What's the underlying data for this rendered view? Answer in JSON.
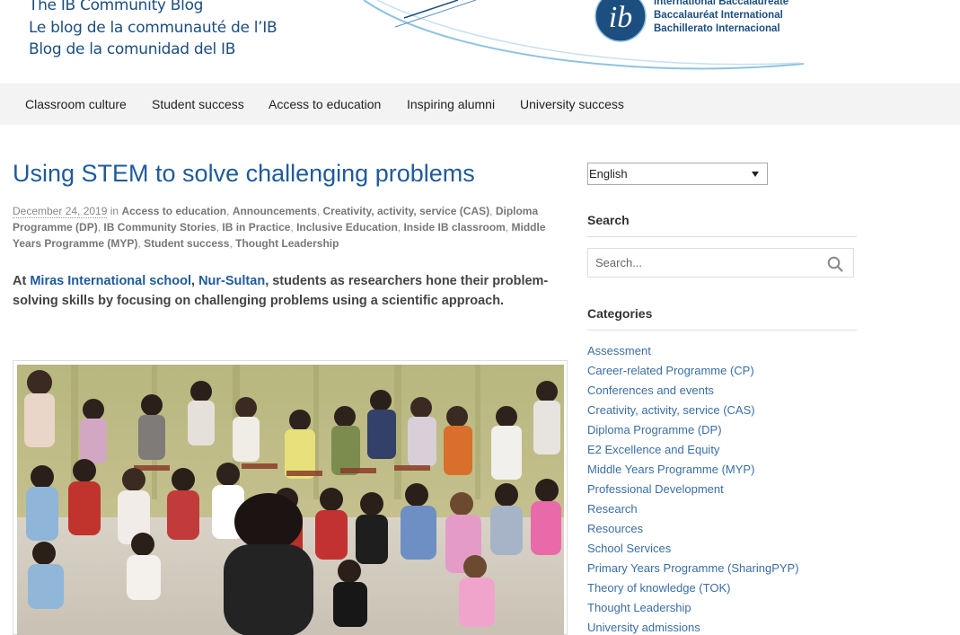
{
  "header": {
    "blog_titles": [
      "The IB Community Blog",
      "Le blog de la communauté de l’IB",
      "Blog de la comunidad del IB"
    ],
    "ib_logo_text": "ib",
    "ib_names": [
      "International Baccalaureate",
      "Baccalauréat International",
      "Bachillerato Internacional"
    ]
  },
  "nav": {
    "items": [
      "Classroom culture",
      "Student success",
      "Access to education",
      "Inspiring alumni",
      "University success"
    ]
  },
  "post": {
    "title": "Using STEM to solve challenging problems",
    "date": "December 24, 2019",
    "in_word": "in",
    "categories": [
      "Access to education",
      "Announcements",
      "Creativity, activity, service (CAS)",
      "Diploma Programme (DP)",
      "IB Community Stories",
      "IB in Practice",
      "Inclusive Education",
      "Inside IB classroom",
      "Middle Years Programme (MYP)",
      "Student success",
      "Thought Leadership"
    ],
    "lead_prefix": "At ",
    "lead_link1": "Miras International school",
    "lead_comma": ", ",
    "lead_link2": "Nur-Sultan",
    "lead_rest": ", students as researchers hone their problem-solving skills by focusing on challenging problems using a scientific approach."
  },
  "sidebar": {
    "language": "English",
    "search_heading": "Search",
    "search_placeholder": "Search...",
    "categories_heading": "Categories",
    "categories": [
      "Assessment",
      "Career-related Programme (CP)",
      "Conferences and events",
      "Creativity, activity, service (CAS)",
      "Diploma Programme (DP)",
      "E2 Excellence and Equity",
      "Middle Years Programme (MYP)",
      "Professional Development",
      "Research",
      "Resources",
      "School Services",
      "Primary Years Programme (SharingPYP)",
      "Theory of knowledge (TOK)",
      "Thought Leadership",
      "University admissions"
    ]
  },
  "colors": {
    "brand_blue": "#1c4e80",
    "link_blue": "#1f5a9b",
    "nav_bg": "#f3f3f3"
  }
}
